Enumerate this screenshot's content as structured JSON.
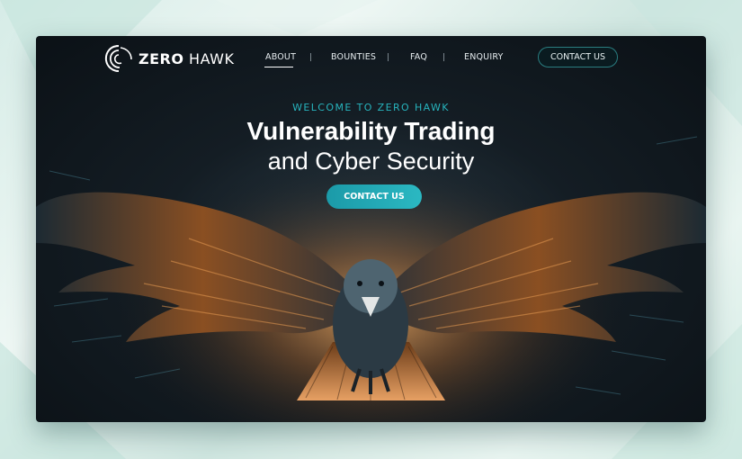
{
  "nav": {
    "logo_bold": "ZERO",
    "logo_light": "HAWK",
    "links": [
      "ABOUT",
      "BOUNTIES",
      "FAQ",
      "ENQUIRY"
    ],
    "separator": "|",
    "contact_label": "CONTACT US"
  },
  "hero": {
    "welcome": "WELCOME TO ZERO HAWK",
    "title_line1": "Vulnerability Trading",
    "title_line2": "and Cyber Security",
    "cta_label": "CONTACT US"
  },
  "colors": {
    "accent": "#27b4bd",
    "page_background": "#dff0ec",
    "hero_dark": "#141d24",
    "wing_glow": "#d98a3c"
  },
  "icons": {
    "logo": "hawk-swirl-logo-icon",
    "hero_image": "hawk-photo"
  }
}
